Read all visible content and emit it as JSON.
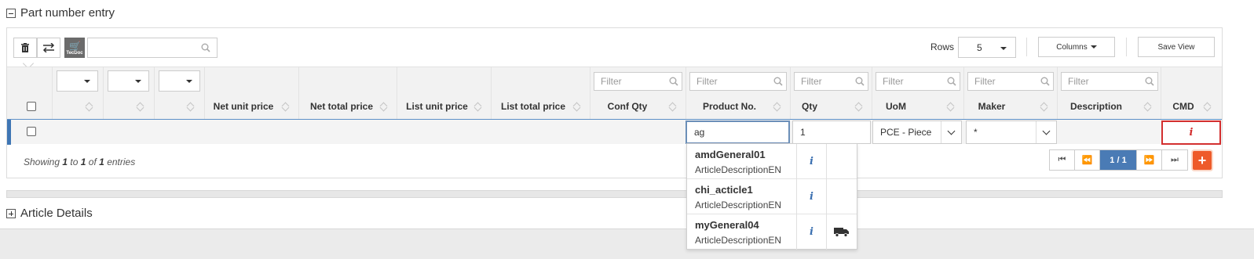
{
  "part_entry": {
    "title": "Part number entry"
  },
  "toolbar": {
    "delete_icon": "trash-icon",
    "swap_icon": "swap-icon",
    "tecdoc_label": "TecDoc",
    "search_value": "",
    "rows_label": "Rows",
    "rows_value": "5",
    "columns_label": "Columns",
    "save_view_label": "Save View"
  },
  "filters": {
    "conf_qty": "Filter",
    "product_no": "Filter",
    "qty": "Filter",
    "uom": "Filter",
    "maker": "Filter",
    "description": "Filter"
  },
  "columns": {
    "net_unit_price": "Net unit price",
    "net_total_price": "Net total price",
    "list_unit_price": "List unit price",
    "list_total_price": "List total price",
    "conf_qty": "Conf Qty",
    "product_no": "Product No.",
    "qty": "Qty",
    "uom": "UoM",
    "maker": "Maker",
    "description": "Description",
    "cmd": "CMD"
  },
  "row": {
    "product_no": "ag",
    "qty": "1",
    "uom": "PCE - Piece",
    "maker": "*",
    "description": "",
    "cmd_icon": "info-icon"
  },
  "suggestions": [
    {
      "code": "amdGeneral01",
      "description": "ArticleDescriptionEN",
      "truck": false
    },
    {
      "code": "chi_acticle1",
      "description": "ArticleDescriptionEN",
      "truck": false
    },
    {
      "code": "myGeneral04",
      "description": "ArticleDescriptionEN",
      "truck": true
    }
  ],
  "footer": {
    "showing_prefix": "Showing",
    "from": "1",
    "to_word": "to",
    "to": "1",
    "of_word": "of",
    "total": "1",
    "suffix": "entries",
    "page_label": "1 / 1"
  },
  "article_details": {
    "title": "Article Details"
  },
  "colors": {
    "accent_blue": "#4a7bb5",
    "add_orange": "#ee5b2a",
    "error_red": "#d32f2f"
  }
}
